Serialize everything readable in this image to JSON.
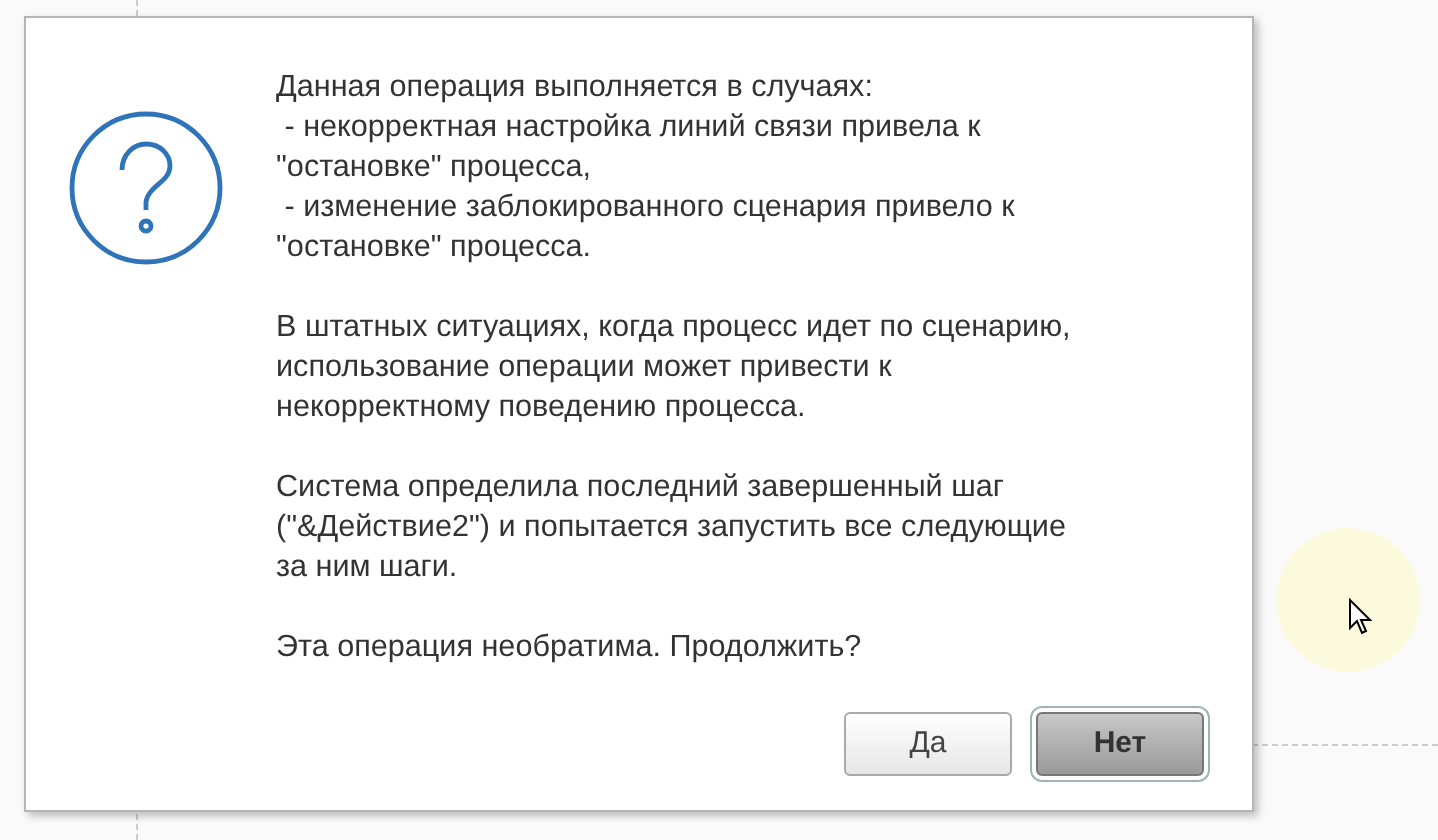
{
  "dialog": {
    "paragraphs": [
      {
        "lines": [
          "Данная операция выполняется в случаях:",
          " - некорректная настройка линий связи привела к",
          "\"остановке\" процесса,",
          " - изменение заблокированного сценария привело к",
          "\"остановке\" процесса."
        ]
      },
      {
        "lines": [
          "В штатных ситуациях, когда процесс идет по сценарию,",
          "использование операции может привести к",
          "некорректному поведению процесса."
        ]
      },
      {
        "lines": [
          "Система определила последний завершенный шаг",
          "(\"&Действие2\") и попытается запустить все следующие",
          "за ним шаги."
        ]
      },
      {
        "lines": [
          "Эта операция необратима. Продолжить?"
        ]
      }
    ],
    "buttons": [
      {
        "label": "Да",
        "default": false
      },
      {
        "label": "Нет",
        "default": true
      }
    ]
  }
}
